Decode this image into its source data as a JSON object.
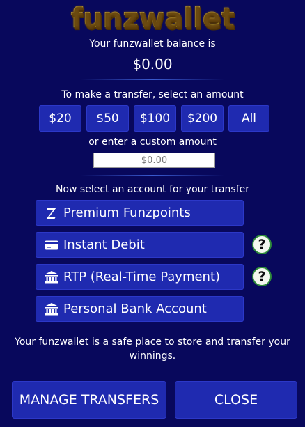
{
  "brand": {
    "logo_text": "funzwallet"
  },
  "balance": {
    "label": "Your funzwallet balance is",
    "value": "$0.00"
  },
  "transfer": {
    "label": "To make a transfer, select an amount",
    "amounts": [
      "$20",
      "$50",
      "$100",
      "$200",
      "All"
    ],
    "custom_label": "or enter a custom amount",
    "custom_placeholder": "$0.00"
  },
  "accounts": {
    "label": "Now select an account for your transfer",
    "items": [
      {
        "label": "Premium Funzpoints",
        "icon": "funzpoints-z-icon",
        "has_help": false
      },
      {
        "label": "Instant Debit",
        "icon": "credit-card-icon",
        "has_help": true
      },
      {
        "label": "RTP (Real-Time Payment)",
        "icon": "bank-icon",
        "has_help": true
      },
      {
        "label": "Personal Bank Account",
        "icon": "bank-icon",
        "has_help": false
      }
    ],
    "help_glyph": "?"
  },
  "footer": {
    "text": "Your funzwallet is a safe place to store and transfer your winnings.",
    "manage_label": "MANAGE TRANSFERS",
    "close_label": "CLOSE"
  },
  "colors": {
    "background": "#08085c",
    "button": "#1f2ab0",
    "help_border": "#2e8b3a",
    "logo_gold": "#e9c84a"
  }
}
